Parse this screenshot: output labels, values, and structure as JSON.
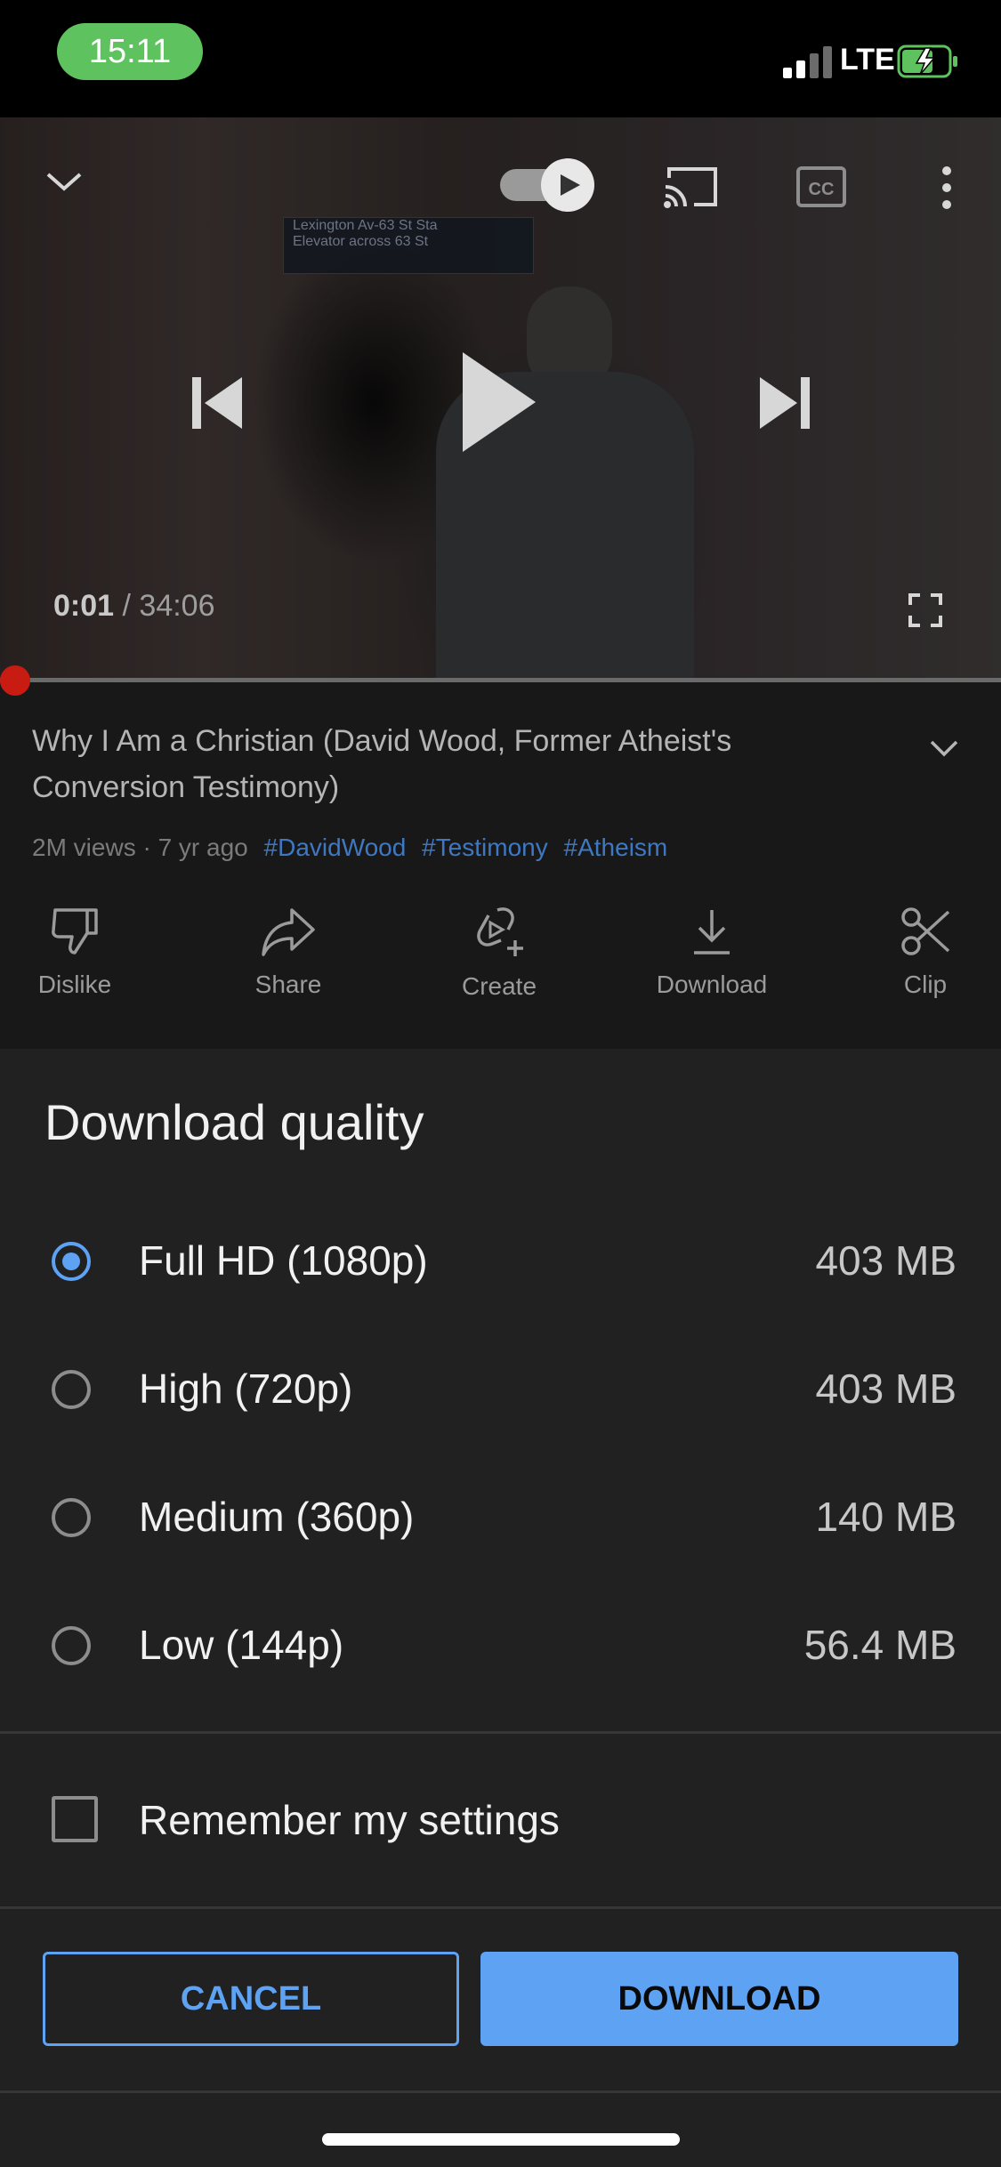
{
  "status_bar": {
    "time": "15:11",
    "network": "LTE"
  },
  "video": {
    "sign_line1": "Lexington Av-63 St Sta",
    "sign_line2": "Elevator across 63 St",
    "current_time": "0:01",
    "duration": "/ 34:06",
    "progress_fraction": 0.0005
  },
  "info": {
    "title": "Why I Am a Christian (David Wood, Former Atheist's Conversion Testimony)",
    "meta": "2M views · 7 yr ago",
    "hashtags": [
      "#DavidWood",
      "#Testimony",
      "#Atheism"
    ],
    "actions": [
      {
        "label": "Dislike",
        "icon": "thumbs-down-icon"
      },
      {
        "label": "Share",
        "icon": "share-icon"
      },
      {
        "label": "Create",
        "icon": "create-icon"
      },
      {
        "label": "Download",
        "icon": "download-icon"
      },
      {
        "label": "Clip",
        "icon": "scissors-icon"
      }
    ]
  },
  "sheet": {
    "title": "Download quality",
    "options": [
      {
        "label": "Full HD (1080p)",
        "size": "403 MB",
        "selected": true
      },
      {
        "label": "High (720p)",
        "size": "403 MB",
        "selected": false
      },
      {
        "label": "Medium (360p)",
        "size": "140 MB",
        "selected": false
      },
      {
        "label": "Low (144p)",
        "size": "56.4 MB",
        "selected": false
      }
    ],
    "remember_label": "Remember my settings",
    "cancel_label": "CANCEL",
    "download_label": "DOWNLOAD"
  },
  "colors": {
    "accent": "#5da2f3",
    "progress": "#c81b12",
    "status_pill": "#5ec25f"
  }
}
